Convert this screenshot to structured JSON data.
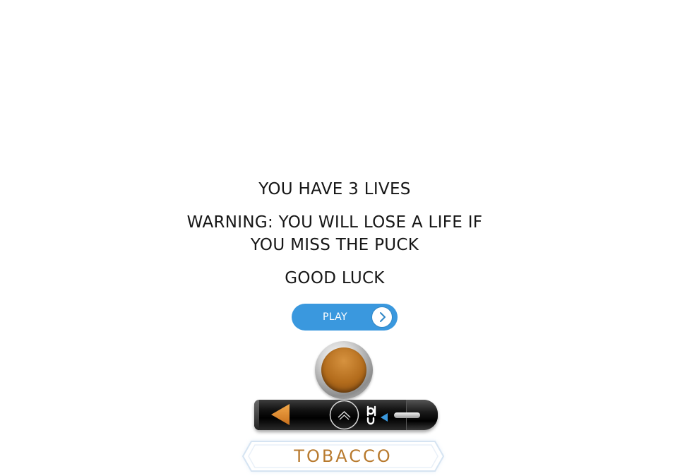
{
  "instructions": {
    "lives": "YOU HAVE 3 LIVES",
    "warning": "WARNING: YOU WILL LOSE A LIFE IF YOU MISS THE PUCK",
    "warning_line1": "WARNING: YOU WILL LOSE A LIFE IF",
    "warning_line2": "YOU MISS THE PUCK",
    "good_luck": "GOOD LUCK"
  },
  "play_button": {
    "label": "PLAY",
    "icon": "chevron-right-icon"
  },
  "paddle": {
    "brand": "blu",
    "left_icon": "triangle-left-icon",
    "center_icon": "chevron-up-icon"
  },
  "flavor": {
    "label": "TOBACCO"
  },
  "colors": {
    "play_button": "#3a98de",
    "puck": "#b36c1c",
    "flavor_text": "#b87a2e",
    "paddle_arrow": "#e28a2b",
    "pointer": "#3a98de"
  }
}
